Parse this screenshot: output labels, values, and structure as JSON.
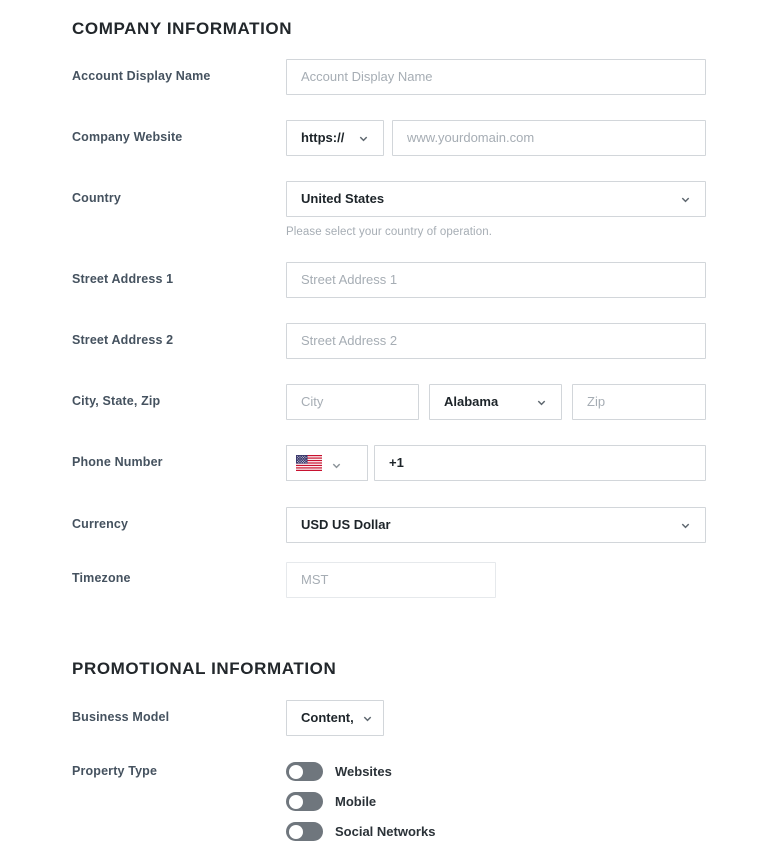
{
  "sections": {
    "company": {
      "title": "COMPANY INFORMATION"
    },
    "promotional": {
      "title": "PROMOTIONAL INFORMATION"
    }
  },
  "fields": {
    "account_display_name": {
      "label": "Account Display Name",
      "placeholder": "Account Display Name",
      "value": ""
    },
    "company_website": {
      "label": "Company Website",
      "protocol_value": "https://",
      "placeholder": "www.yourdomain.com",
      "value": ""
    },
    "country": {
      "label": "Country",
      "value": "United States",
      "helper": "Please select your country of operation."
    },
    "street_address_1": {
      "label": "Street Address 1",
      "placeholder": "Street Address 1",
      "value": ""
    },
    "street_address_2": {
      "label": "Street Address 2",
      "placeholder": "Street Address 2",
      "value": ""
    },
    "city_state_zip": {
      "label": "City, State, Zip",
      "city_placeholder": "City",
      "city_value": "",
      "state_value": "Alabama",
      "zip_placeholder": "Zip",
      "zip_value": ""
    },
    "phone_number": {
      "label": "Phone Number",
      "flag": "us-flag-icon",
      "value": "+1"
    },
    "currency": {
      "label": "Currency",
      "value": "USD US Dollar"
    },
    "timezone": {
      "label": "Timezone",
      "placeholder": "MST",
      "value": ""
    },
    "business_model": {
      "label": "Business Model",
      "value": "Content,"
    },
    "property_type": {
      "label": "Property Type",
      "options": [
        {
          "label": "Websites",
          "on": false
        },
        {
          "label": "Mobile",
          "on": false
        },
        {
          "label": "Social Networks",
          "on": false
        }
      ]
    }
  },
  "icons": {
    "chevron_down": "chevron-down-icon"
  },
  "colors": {
    "label": "#45525f",
    "value": "#1d2429",
    "placeholder": "#a6adb4",
    "border": "#d2d6da",
    "border_disabled": "#e6e9ec",
    "toggle_off": "#6f767d",
    "heading": "#22272b"
  }
}
